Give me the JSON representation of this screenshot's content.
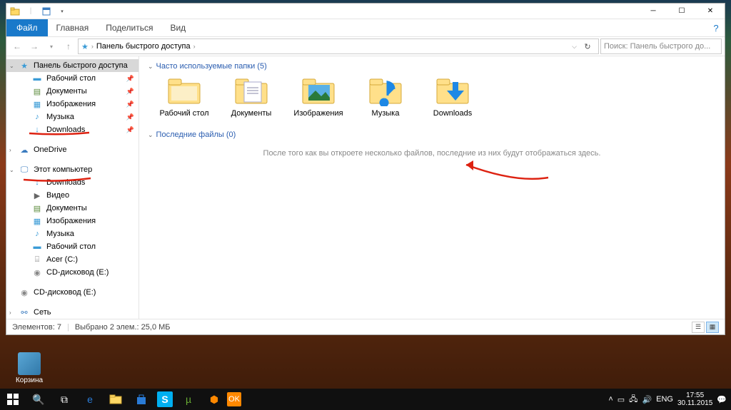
{
  "window": {
    "ribbon": {
      "file": "Файл",
      "tabs": [
        "Главная",
        "Поделиться",
        "Вид"
      ]
    },
    "address": {
      "crumb": "Панель быстрого доступа",
      "search_placeholder": "Поиск: Панель быстрого до..."
    },
    "nav": {
      "quick_access": "Панель быстрого доступа",
      "items_qa": [
        {
          "label": "Рабочий стол",
          "icon": "desktop",
          "pin": true
        },
        {
          "label": "Документы",
          "icon": "doc",
          "pin": true
        },
        {
          "label": "Изображения",
          "icon": "pic",
          "pin": true
        },
        {
          "label": "Музыка",
          "icon": "music",
          "pin": true
        },
        {
          "label": "Downloads",
          "icon": "download",
          "pin": true,
          "marked": true
        }
      ],
      "onedrive": "OneDrive",
      "thispc": "Этот компьютер",
      "items_pc": [
        {
          "label": "Downloads",
          "icon": "download",
          "marked": true
        },
        {
          "label": "Видео",
          "icon": "video"
        },
        {
          "label": "Документы",
          "icon": "doc"
        },
        {
          "label": "Изображения",
          "icon": "pic"
        },
        {
          "label": "Музыка",
          "icon": "music"
        },
        {
          "label": "Рабочий стол",
          "icon": "desktop"
        },
        {
          "label": "Acer (C:)",
          "icon": "drive"
        },
        {
          "label": "CD-дисковод (E:)",
          "icon": "cd"
        }
      ],
      "cd_detached": "CD-дисковод (E:)",
      "network": "Сеть"
    },
    "content": {
      "group_folders": "Часто используемые папки (5)",
      "folders": [
        {
          "label": "Рабочий стол",
          "kind": "folder"
        },
        {
          "label": "Документы",
          "kind": "doc"
        },
        {
          "label": "Изображения",
          "kind": "pic"
        },
        {
          "label": "Музыка",
          "kind": "music"
        },
        {
          "label": "Downloads",
          "kind": "download"
        }
      ],
      "group_recent": "Последние файлы (0)",
      "recent_empty_msg": "После того как вы откроете несколько файлов, последние из них будут отображаться здесь."
    },
    "status": {
      "items": "Элементов: 7",
      "selection": "Выбрано 2 элем.: 25,0 МБ"
    }
  },
  "desktop": {
    "recycle": "Корзина"
  },
  "taskbar": {
    "lang": "ENG",
    "time": "17:55",
    "date": "30.11.2015"
  }
}
